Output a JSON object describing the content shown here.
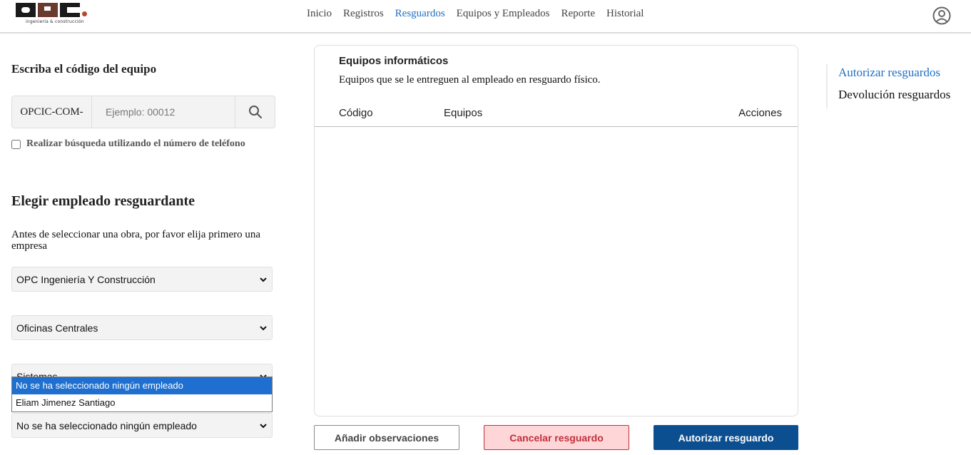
{
  "logo": {
    "tagline": "ingeniería & construcción"
  },
  "nav": {
    "items": [
      "Inicio",
      "Registros",
      "Resguardos",
      "Equipos y Empleados",
      "Reporte",
      "Historial"
    ],
    "active": "Resguardos"
  },
  "search": {
    "title": "Escriba el código del equipo",
    "prefix": "OPCIC-COM-",
    "placeholder": "Ejemplo: 00012",
    "phone_checkbox_label": "Realizar búsqueda utilizando el número de teléfono"
  },
  "employee": {
    "title": "Elegir empleado resguardante",
    "hint": "Antes de seleccionar una obra, por favor elija primero una empresa",
    "company_value": "OPC Ingeniería Y Construcción",
    "site_value": "Oficinas Centrales",
    "department_value": "Sistemas",
    "employee_value": "No se ha seleccionado ningún empleado",
    "dropdown_options": [
      "No se ha seleccionado ningún empleado",
      "Eliam Jimenez Santiago"
    ]
  },
  "card": {
    "title": "Equipos informáticos",
    "subtitle": "Equipos que se le entreguen al empleado en resguardo físico.",
    "columns": [
      "Código",
      "Equipos",
      "Acciones"
    ]
  },
  "buttons": {
    "observations": "Añadir observaciones",
    "cancel": "Cancelar resguardo",
    "authorize": "Autorizar resguardo"
  },
  "sidenav": {
    "items": [
      "Autorizar resguardos",
      "Devolución resguardos"
    ],
    "active": "Autorizar resguardos"
  },
  "colors": {
    "link_blue": "#1f6fc4",
    "primary_button": "#0b4f91",
    "cancel_border": "#c0303a",
    "cancel_bg": "#ffd6d8",
    "selected_option": "#1e6fd0"
  }
}
